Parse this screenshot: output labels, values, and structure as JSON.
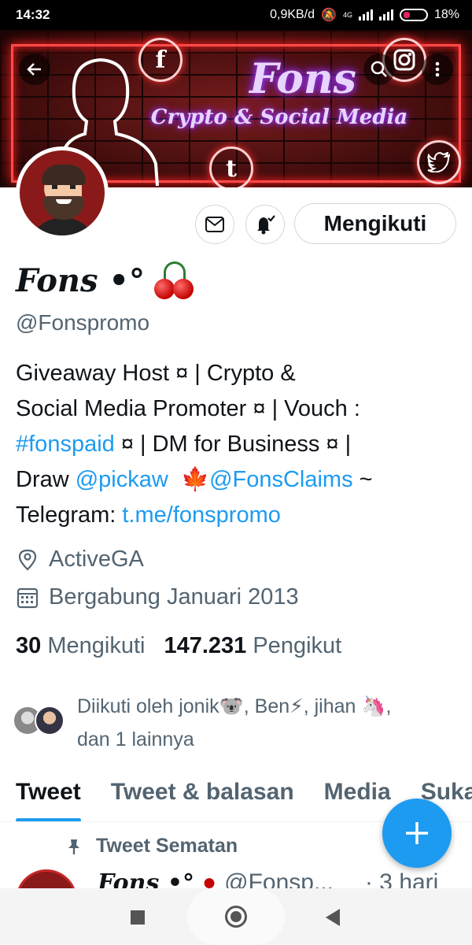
{
  "status_bar": {
    "time": "14:32",
    "net_speed": "0,9KB/d",
    "network_type": "4G",
    "battery": "18%"
  },
  "banner": {
    "title": "Fons",
    "subtitle": "Crypto & Social Media",
    "icons": [
      "facebook-icon",
      "instagram-icon",
      "tumblr-icon",
      "twitter-icon"
    ]
  },
  "toolbar": {
    "back_icon": "arrow-left-icon",
    "search_icon": "search-icon",
    "more_icon": "more-vertical-icon"
  },
  "profile": {
    "display_name": "Fons •°",
    "handle": "@Fonspromo",
    "follow_button": "Mengikuti",
    "bio": {
      "line1": "Giveaway Host ¤ | Crypto &",
      "line2": "Social Media Promoter ¤ | Vouch :",
      "line3_link": "#fonspaid",
      "line3_rest": " ¤ | DM for Business ¤ |",
      "line4_prefix": "Draw ",
      "line4_link1": "@pickaw",
      "line4_leaf": "🍁",
      "line4_link2": "@FonsClaims",
      "line4_suffix": " ~",
      "line5_prefix": "Telegram: ",
      "line5_link": "t.me/fonspromo"
    },
    "location": "ActiveGA",
    "joined": "Bergabung Januari 2013",
    "following_count": "30",
    "following_label": "Mengikuti",
    "followers_count": "147.231",
    "followers_label": "Pengikut",
    "followed_by": {
      "line1": "Diikuti oleh jonik🐨, Ben⚡, jihan 🦄,",
      "line2": "dan 1 lainnya"
    }
  },
  "tabs": [
    {
      "label": "Tweet",
      "active": true
    },
    {
      "label": "Tweet & balasan",
      "active": false
    },
    {
      "label": "Media",
      "active": false
    },
    {
      "label": "Suka",
      "active": false
    }
  ],
  "pinned": {
    "label": "Tweet Sematan",
    "tweet_name": "Fons •°",
    "tweet_handle": "@Fonsp...",
    "tweet_time": "· 3 hari"
  },
  "colors": {
    "accent": "#1d9bf0",
    "text": "#0f1419",
    "muted": "#536471",
    "border": "#cfd9de"
  }
}
